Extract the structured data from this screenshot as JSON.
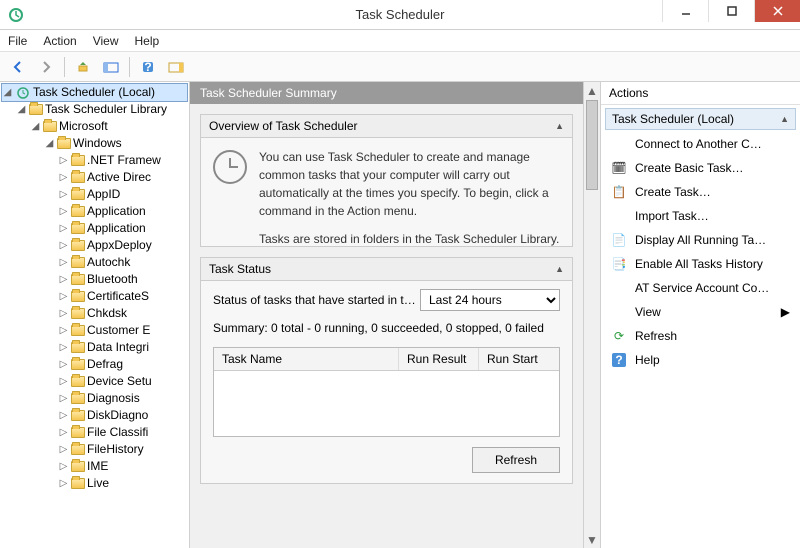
{
  "window": {
    "title": "Task Scheduler"
  },
  "menu": {
    "file": "File",
    "action": "Action",
    "view": "View",
    "help": "Help"
  },
  "tree": {
    "root": "Task Scheduler (Local)",
    "lib": "Task Scheduler Library",
    "ms": "Microsoft",
    "win": "Windows",
    "items": [
      ".NET Framew",
      "Active Direc",
      "AppID",
      "Application",
      "Application",
      "AppxDeploy",
      "Autochk",
      "Bluetooth",
      "CertificateS",
      "Chkdsk",
      "Customer E",
      "Data Integri",
      "Defrag",
      "Device Setu",
      "Diagnosis",
      "DiskDiagno",
      "File Classifi",
      "FileHistory",
      "IME",
      "Live"
    ]
  },
  "summary": {
    "header": "Task Scheduler Summary",
    "overview_title": "Overview of Task Scheduler",
    "overview_text1": "You can use Task Scheduler to create and manage common tasks that your computer will carry out automatically at the times you specify. To begin, click a command in the Action menu.",
    "overview_text2": "Tasks are stored in folders in the Task Scheduler Library. To view or perform an operation on an",
    "status_title": "Task Status",
    "status_label": "Status of tasks that have started in t…",
    "status_period": "Last 24 hours",
    "status_summary": "Summary: 0 total - 0 running, 0 succeeded, 0 stopped, 0 failed",
    "cols": {
      "name": "Task Name",
      "result": "Run Result",
      "start": "Run Start"
    },
    "refresh": "Refresh"
  },
  "actions": {
    "title": "Actions",
    "context": "Task Scheduler (Local)",
    "items": {
      "connect": "Connect to Another C…",
      "basic": "Create Basic Task…",
      "create": "Create Task…",
      "import": "Import Task…",
      "display": "Display All Running Ta…",
      "enable": "Enable All Tasks History",
      "atsvc": "AT Service Account Co…",
      "view": "View",
      "refresh": "Refresh",
      "help": "Help"
    }
  }
}
